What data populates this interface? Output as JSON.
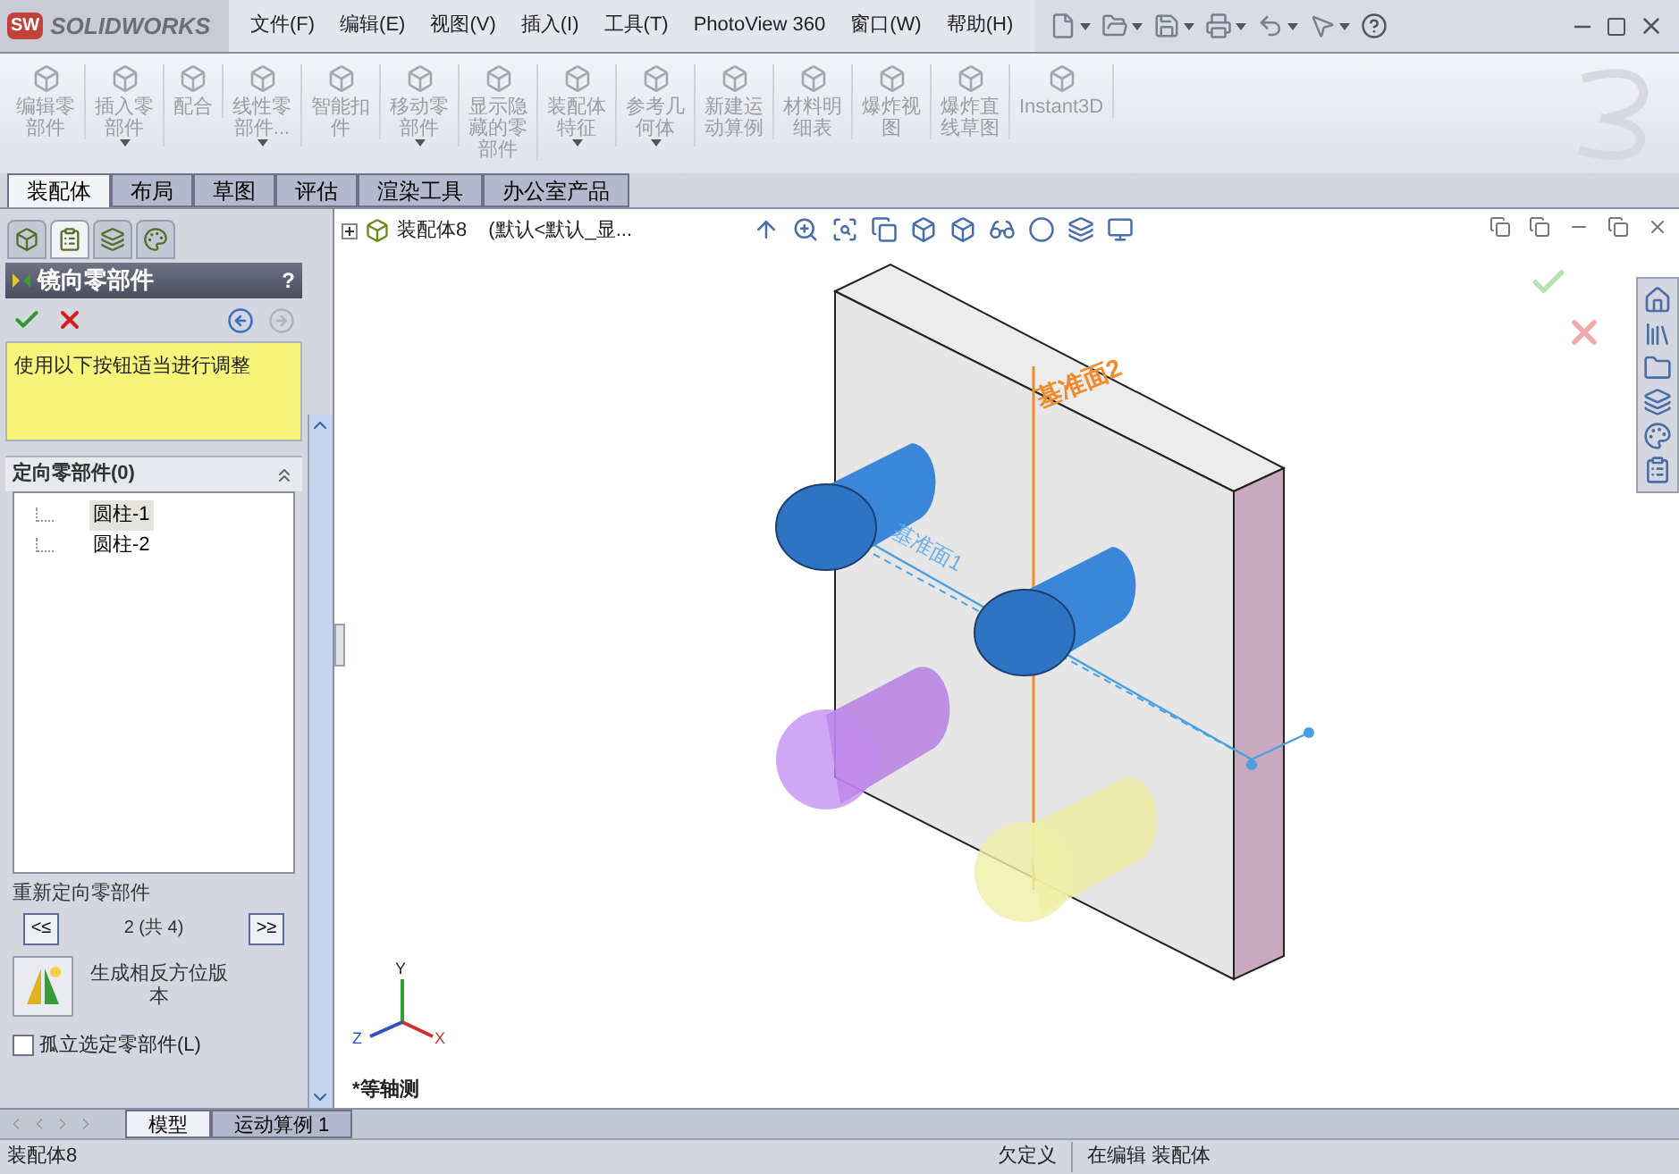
{
  "app": {
    "logo_badge": "SW",
    "logo": "SOLIDWORKS"
  },
  "menu": [
    "文件(F)",
    "编辑(E)",
    "视图(V)",
    "插入(I)",
    "工具(T)",
    "PhotoView 360",
    "窗口(W)",
    "帮助(H)"
  ],
  "ribbon": [
    {
      "lines": [
        "编辑零",
        "部件"
      ],
      "disabled": true,
      "dropdown": false
    },
    {
      "lines": [
        "插入零",
        "部件"
      ],
      "disabled": true,
      "dropdown": true
    },
    {
      "lines": [
        "配合"
      ],
      "disabled": true,
      "dropdown": false
    },
    {
      "lines": [
        "线性零",
        "部件..."
      ],
      "disabled": true,
      "dropdown": true
    },
    {
      "lines": [
        "智能扣",
        "件"
      ],
      "disabled": true,
      "dropdown": false
    },
    {
      "lines": [
        "移动零",
        "部件"
      ],
      "disabled": true,
      "dropdown": true
    },
    {
      "lines": [
        "显示隐",
        "藏的零",
        "部件"
      ],
      "disabled": true,
      "dropdown": false
    },
    {
      "lines": [
        "装配体",
        "特征"
      ],
      "disabled": true,
      "dropdown": true
    },
    {
      "lines": [
        "参考几",
        "何体"
      ],
      "disabled": true,
      "dropdown": true
    },
    {
      "lines": [
        "新建运",
        "动算例"
      ],
      "disabled": true,
      "dropdown": false
    },
    {
      "lines": [
        "材料明",
        "细表"
      ],
      "disabled": true,
      "dropdown": false
    },
    {
      "lines": [
        "爆炸视",
        "图"
      ],
      "disabled": true,
      "dropdown": false
    },
    {
      "lines": [
        "爆炸直",
        "线草图"
      ],
      "disabled": true,
      "dropdown": false
    },
    {
      "lines": [
        "Instant3D"
      ],
      "disabled": true,
      "dropdown": false
    }
  ],
  "tabs": [
    {
      "label": "装配体",
      "selected": true
    },
    {
      "label": "布局",
      "selected": false
    },
    {
      "label": "草图",
      "selected": false
    },
    {
      "label": "评估",
      "selected": false
    },
    {
      "label": "渲染工具",
      "selected": false
    },
    {
      "label": "办公室产品",
      "selected": false
    }
  ],
  "panel_tabs": [
    {
      "selected": false
    },
    {
      "selected": true
    },
    {
      "selected": false
    },
    {
      "selected": false
    }
  ],
  "property_manager": {
    "title": "镜向零部件",
    "help": "?",
    "message": "使用以下按钮适当进行调整",
    "section_title": "定向零部件(0)",
    "components": [
      {
        "label": "圆柱-1",
        "selected": true
      },
      {
        "label": "圆柱-2",
        "selected": false
      }
    ],
    "reorient_label": "重新定向零部件",
    "prev": "<≤",
    "counter": "2 (共 4)",
    "next": ">≥",
    "opposite_label": "生成相反方位版本",
    "isolate": {
      "label": "孤立选定零部件(L)",
      "checked": false
    }
  },
  "feature_tree": {
    "name": "装配体8",
    "config": "(默认<默认_显..."
  },
  "planes": [
    "基准面2",
    "基准面1"
  ],
  "triad": {
    "x": "X",
    "y": "Y",
    "z": "Z"
  },
  "view_name": "*等轴测",
  "bottom_tabs": [
    {
      "label": "模型",
      "selected": true
    },
    {
      "label": "运动算例 1",
      "selected": false
    }
  ],
  "status_bar": {
    "document": "装配体8",
    "state": "欠定义",
    "mode": "在编辑 装配体"
  }
}
